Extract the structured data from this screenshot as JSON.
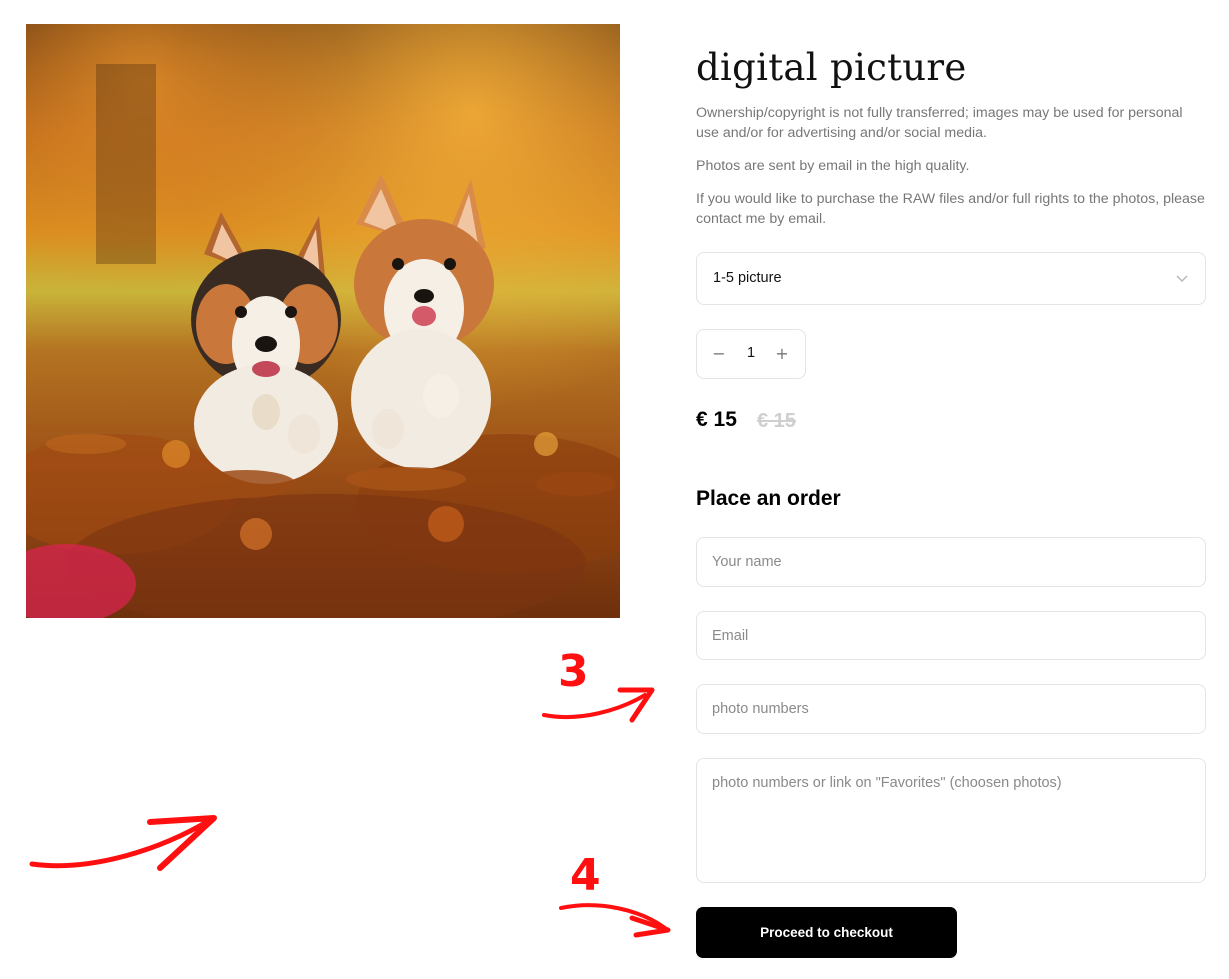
{
  "product": {
    "title": "digital picture",
    "description": [
      "Ownership/copyright is not fully transferred; images may be used for personal use and/or for advertising and/or social media.",
      "Photos are sent by email in the high quality.",
      "If you would like to purchase the RAW files and/or full rights to the photos, please contact me by email."
    ],
    "image_icon": "corgi-photo"
  },
  "option_select": {
    "selected": "1-5 picture",
    "icon": "chevron-down-icon"
  },
  "quantity": {
    "value": "1",
    "minus": "−",
    "plus": "+"
  },
  "price": {
    "current": "€ 15",
    "old": "€ 15"
  },
  "order_form": {
    "heading": "Place an order",
    "name_placeholder": "Your name",
    "email_placeholder": "Email",
    "photo_numbers_placeholder": "photo numbers",
    "notes_placeholder": "photo numbers or link on \"Favorites\" (choosen photos)",
    "submit_label": "Proceed to checkout"
  },
  "annotations": {
    "step_3": "3",
    "step_4": "4",
    "color": "#ff0f0f"
  }
}
